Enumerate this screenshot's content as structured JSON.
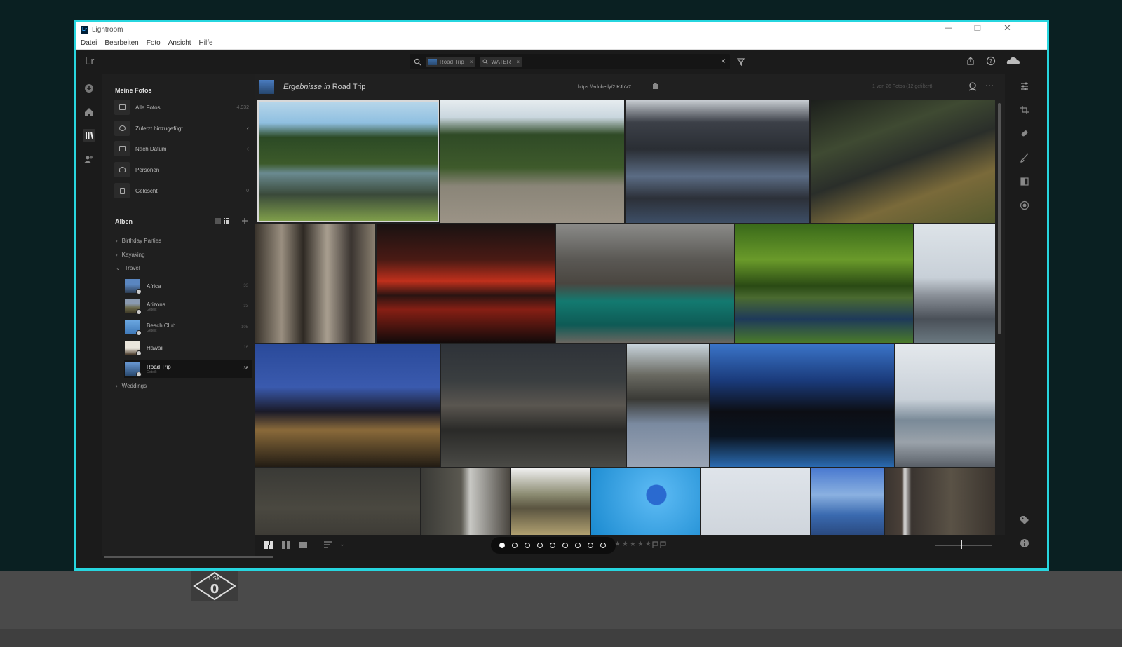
{
  "window": {
    "title": "Lightroom",
    "app_badge": "Lr",
    "menu": [
      "Datei",
      "Bearbeiten",
      "Foto",
      "Ansicht",
      "Hilfe"
    ]
  },
  "topbar": {
    "logo": "Lr",
    "search_chips": [
      {
        "label": "Road Trip",
        "icon": "album-thumb"
      },
      {
        "label": "WATER",
        "icon": "search-icon"
      }
    ],
    "clear_symbol": "×"
  },
  "sidebar": {
    "my_photos_title": "Meine Fotos",
    "nav_items": [
      {
        "label": "Alle Fotos",
        "count": "4,932",
        "icon": "photo-icon"
      },
      {
        "label": "Zuletzt hinzugefügt",
        "count": "",
        "icon": "clock-icon",
        "expand": "‹"
      },
      {
        "label": "Nach Datum",
        "count": "",
        "icon": "calendar-icon",
        "expand": "‹"
      },
      {
        "label": "Personen",
        "count": "",
        "icon": "person-icon"
      },
      {
        "label": "Gelöscht",
        "count": "0",
        "icon": "trash-icon"
      }
    ],
    "albums_title": "Alben",
    "folders": [
      {
        "label": "Birthday Parties",
        "arrow": "›"
      },
      {
        "label": "Kayaking",
        "arrow": "›"
      },
      {
        "label": "Travel",
        "arrow": "⌄"
      }
    ],
    "albums": [
      {
        "name": "Africa",
        "sub": "",
        "count": "33",
        "color": "#4d6f9c"
      },
      {
        "name": "Arizona",
        "sub": "Geteilt",
        "count": "33",
        "color": "#6d6a4a"
      },
      {
        "name": "Beach Club",
        "sub": "Geteilt",
        "count": "105",
        "color": "#3e78b8"
      },
      {
        "name": "Hawaii",
        "sub": "",
        "count": "16",
        "color": "#d8d3c8"
      },
      {
        "name": "Road Trip",
        "sub": "Geteilt",
        "count": "38",
        "color": "#3b6aa8"
      }
    ],
    "last_folder": {
      "label": "Weddings",
      "arrow": "›"
    }
  },
  "content": {
    "results_prefix": "Ergebnisse",
    "results_in": "in",
    "results_album": "Road Trip",
    "share_link": "https://adobe.ly/2IKJbV7",
    "count_text": "1 von 26 Fotos   (12 gefiltert)"
  },
  "bottombar": {
    "pager_dots_total": 9,
    "pager_active_index": 0,
    "stars": "★★★★★"
  },
  "overlay": {
    "usk_rating": "0",
    "usk_label": "USK"
  },
  "colors": {
    "accent_border": "#27d6df",
    "background": "#0a2022"
  }
}
